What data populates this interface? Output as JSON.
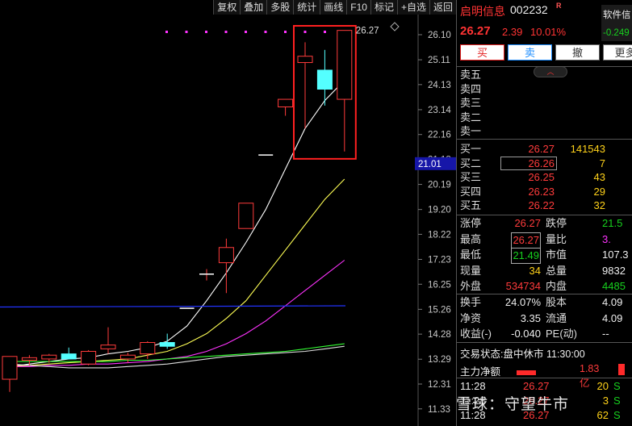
{
  "toolbar": [
    "复权",
    "叠加",
    "多股",
    "统计",
    "画线",
    "F10",
    "标记",
    "+自选",
    "返回"
  ],
  "chart": {
    "price_axis": [
      "26.10",
      "25.11",
      "24.13",
      "23.14",
      "22.16",
      "21.18",
      "20.19",
      "19.20",
      "18.22",
      "17.23",
      "16.25",
      "15.26",
      "14.28",
      "13.29",
      "12.31",
      "11.33"
    ],
    "high_label": "26.27",
    "current_price_tag": "21.01",
    "colors": {
      "up": "#ff3b3b",
      "down": "#54ffff",
      "ma5": "#ffffff",
      "ma10": "#ffff55",
      "ma20": "#ff33ff",
      "ma60": "#33ff33",
      "ref_line": "#2233ff",
      "highlight_box": "#ff2020"
    }
  },
  "chart_data": {
    "type": "candlestick",
    "ylim": [
      11.33,
      26.6
    ],
    "candles": [
      {
        "o": 12.5,
        "h": 13.4,
        "l": 12.0,
        "c": 13.4
      },
      {
        "o": 13.25,
        "h": 13.45,
        "l": 13.05,
        "c": 13.35
      },
      {
        "o": 13.3,
        "h": 13.5,
        "l": 13.15,
        "c": 13.45
      },
      {
        "o": 13.5,
        "h": 13.75,
        "l": 13.3,
        "c": 13.3
      },
      {
        "o": 13.1,
        "h": 13.65,
        "l": 13.05,
        "c": 13.6
      },
      {
        "o": 13.7,
        "h": 14.55,
        "l": 13.5,
        "c": 13.85
      },
      {
        "o": 13.3,
        "h": 13.55,
        "l": 13.15,
        "c": 13.45
      },
      {
        "o": 13.5,
        "h": 14.0,
        "l": 13.3,
        "c": 13.95
      },
      {
        "o": 13.95,
        "h": 14.3,
        "l": 13.7,
        "c": 13.8
      },
      {
        "o": 15.3,
        "h": 15.3,
        "l": 15.3,
        "c": 15.3
      },
      {
        "o": 16.65,
        "h": 16.85,
        "l": 16.4,
        "c": 16.65
      },
      {
        "o": 17.1,
        "h": 18.05,
        "l": 15.9,
        "c": 17.7
      },
      {
        "o": 18.45,
        "h": 19.45,
        "l": 18.45,
        "c": 19.45
      },
      {
        "o": 21.35,
        "h": 21.35,
        "l": 21.35,
        "c": 21.35
      },
      {
        "o": 23.25,
        "h": 23.55,
        "l": 22.9,
        "c": 23.55
      },
      {
        "o": 25.0,
        "h": 25.8,
        "l": 22.4,
        "c": 25.25
      },
      {
        "o": 24.7,
        "h": 25.5,
        "l": 23.3,
        "c": 23.95
      },
      {
        "o": 23.55,
        "h": 26.27,
        "l": 21.49,
        "c": 26.27
      }
    ],
    "series": [
      {
        "name": "MA5",
        "values": [
          13.0,
          13.1,
          13.2,
          13.3,
          13.35,
          13.5,
          13.6,
          13.75,
          14.0,
          14.6,
          15.6,
          16.7,
          17.9,
          19.2,
          20.8,
          22.4,
          23.5,
          24.3
        ]
      },
      {
        "name": "MA10",
        "values": [
          13.0,
          13.05,
          13.1,
          13.15,
          13.2,
          13.25,
          13.3,
          13.45,
          13.6,
          13.9,
          14.3,
          14.9,
          15.6,
          16.6,
          17.6,
          18.6,
          19.6,
          20.4
        ]
      },
      {
        "name": "MA20",
        "values": [
          13.0,
          13.0,
          13.05,
          13.05,
          13.1,
          13.1,
          13.15,
          13.2,
          13.3,
          13.4,
          13.6,
          13.9,
          14.3,
          14.8,
          15.4,
          16.0,
          16.6,
          17.2
        ]
      },
      {
        "name": "MA60",
        "values": [
          13.2,
          13.2,
          13.2,
          13.2,
          13.2,
          13.2,
          13.25,
          13.25,
          13.3,
          13.35,
          13.4,
          13.45,
          13.5,
          13.55,
          13.6,
          13.7,
          13.8,
          13.9
        ]
      },
      {
        "name": "MA120",
        "values": [
          13.1,
          13.05,
          13.0,
          12.95,
          12.95,
          12.95,
          13.0,
          13.05,
          13.1,
          13.2,
          13.3,
          13.4,
          13.45,
          13.5,
          13.55,
          13.6,
          13.7,
          13.8
        ]
      },
      {
        "name": "ref",
        "values": [
          15.35,
          15.35,
          15.35,
          15.35,
          15.35,
          15.35,
          15.35,
          15.35,
          15.35,
          15.35,
          15.35,
          15.35,
          15.35,
          15.35,
          15.35,
          15.35,
          15.35,
          15.4
        ]
      }
    ]
  },
  "panel": {
    "name": "启明信息",
    "code": "002232",
    "badge": "R",
    "sw_title": "软件信",
    "sw_change": "-0.249",
    "last": "26.27",
    "change": "2.39",
    "pct": "10.01%",
    "buttons": [
      "买",
      "卖",
      "撤",
      "更多"
    ],
    "asks": [
      {
        "label": "卖五",
        "price": "",
        "vol": ""
      },
      {
        "label": "卖四",
        "price": "",
        "vol": ""
      },
      {
        "label": "卖三",
        "price": "",
        "vol": ""
      },
      {
        "label": "卖二",
        "price": "",
        "vol": ""
      },
      {
        "label": "卖一",
        "price": "",
        "vol": ""
      }
    ],
    "bids": [
      {
        "label": "买一",
        "price": "26.27",
        "vol": "141543"
      },
      {
        "label": "买二",
        "price": "26.26",
        "vol": "7"
      },
      {
        "label": "买三",
        "price": "26.25",
        "vol": "43"
      },
      {
        "label": "买四",
        "price": "26.23",
        "vol": "29"
      },
      {
        "label": "买五",
        "price": "26.22",
        "vol": "32"
      }
    ],
    "stats": [
      {
        "l1": "涨停",
        "v1": "26.27",
        "l2": "跌停",
        "v2": "21.5"
      },
      {
        "l1": "最高",
        "v1": "26.27",
        "l2": "量比",
        "v2": "3."
      },
      {
        "l1": "最低",
        "v1": "21.49",
        "l2": "市值",
        "v2": "107.3"
      },
      {
        "l1": "现量",
        "v1": "34",
        "l2": "总量",
        "v2": "9832"
      },
      {
        "l1": "外盘",
        "v1": "534734",
        "l2": "内盘",
        "v2": "4485"
      }
    ],
    "stats2": [
      {
        "l1": "换手",
        "v1": "24.07%",
        "l2": "股本",
        "v2": "4.09"
      },
      {
        "l1": "净资",
        "v1": "3.35",
        "l2": "流通",
        "v2": "4.09"
      },
      {
        "l1": "收益(-)",
        "v1": "-0.040",
        "l2": "PE(动)",
        "v2": "--"
      }
    ],
    "status_label": "交易状态:",
    "status_value": "盘中休市",
    "status_time": "11:30:00",
    "flow_label": "主力净额",
    "flow_value": "1.83亿",
    "ticks": [
      {
        "t": "11:28",
        "p": "26.27",
        "v": "20",
        "s": "S"
      },
      {
        "t": "11:28",
        "p": "26.27",
        "v": "3",
        "s": "S"
      },
      {
        "t": "11:28",
        "p": "26.27",
        "v": "62",
        "s": "S"
      }
    ],
    "watermark": "雪球：守望牛市"
  }
}
